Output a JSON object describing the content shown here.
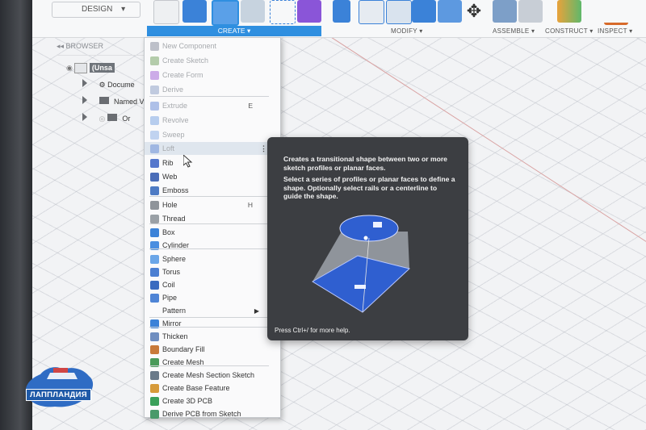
{
  "toolbar": {
    "workspace_label": "DESIGN",
    "tabs": [
      {
        "label": "CREATE ▾"
      },
      {
        "label": "MODIFY ▾"
      },
      {
        "label": "ASSEMBLE ▾"
      },
      {
        "label": "CONSTRUCT ▾"
      },
      {
        "label": "INSPECT ▾"
      }
    ]
  },
  "browser": {
    "title": "BROWSER",
    "items": [
      "(Unsa",
      "Docume",
      "Named V",
      "Or"
    ]
  },
  "menu": {
    "items": [
      {
        "label": "New Component",
        "icon": "new-component-icon",
        "disabled": true
      },
      {
        "label": "Create Sketch",
        "icon": "sketch-icon",
        "disabled": true
      },
      {
        "label": "Create Form",
        "icon": "form-icon",
        "disabled": true
      },
      {
        "label": "Derive",
        "icon": "derive-icon",
        "disabled": true
      },
      {
        "label": "Extrude",
        "icon": "extrude-icon",
        "disabled": true,
        "shortcut": "E"
      },
      {
        "label": "Revolve",
        "icon": "revolve-icon",
        "disabled": true
      },
      {
        "label": "Sweep",
        "icon": "sweep-icon",
        "disabled": true
      },
      {
        "label": "Loft",
        "icon": "loft-icon",
        "disabled": true,
        "highlighted": true
      },
      {
        "label": "Rib",
        "icon": "rib-icon"
      },
      {
        "label": "Web",
        "icon": "web-icon"
      },
      {
        "label": "Emboss",
        "icon": "emboss-icon"
      },
      {
        "label": "Hole",
        "icon": "hole-icon",
        "shortcut": "H"
      },
      {
        "label": "Thread",
        "icon": "thread-icon"
      },
      {
        "label": "Box",
        "icon": "box-icon"
      },
      {
        "label": "Cylinder",
        "icon": "cylinder-icon"
      },
      {
        "label": "Sphere",
        "icon": "sphere-icon"
      },
      {
        "label": "Torus",
        "icon": "torus-icon"
      },
      {
        "label": "Coil",
        "icon": "coil-icon"
      },
      {
        "label": "Pipe",
        "icon": "pipe-icon"
      },
      {
        "label": "Pattern",
        "icon": "",
        "submenu": true
      },
      {
        "label": "Mirror",
        "icon": "mirror-icon"
      },
      {
        "label": "Thicken",
        "icon": "thicken-icon"
      },
      {
        "label": "Boundary Fill",
        "icon": "boundary-fill-icon"
      },
      {
        "label": "Create Mesh",
        "icon": "mesh-icon"
      },
      {
        "label": "Create Mesh Section Sketch",
        "icon": "mesh-section-icon"
      },
      {
        "label": "Create Base Feature",
        "icon": "base-feature-icon"
      },
      {
        "label": "Create 3D PCB",
        "icon": "pcb-icon"
      },
      {
        "label": "Derive PCB from Sketch",
        "icon": "derive-pcb-icon"
      }
    ]
  },
  "tooltip": {
    "summary": "Creates a transitional shape between two or more sketch profiles or planar faces.",
    "detail": "Select a series of profiles or planar faces to define a shape. Optionally select rails or a centerline to guide the shape.",
    "footer": "Press Ctrl+/ for more help."
  },
  "logo": {
    "text": "ЛАППЛАНДИЯ"
  },
  "colors": {
    "accent": "#2f8fe0",
    "tooltip_bg": "#3c3e42",
    "profile_blue": "#2f5fd0"
  }
}
